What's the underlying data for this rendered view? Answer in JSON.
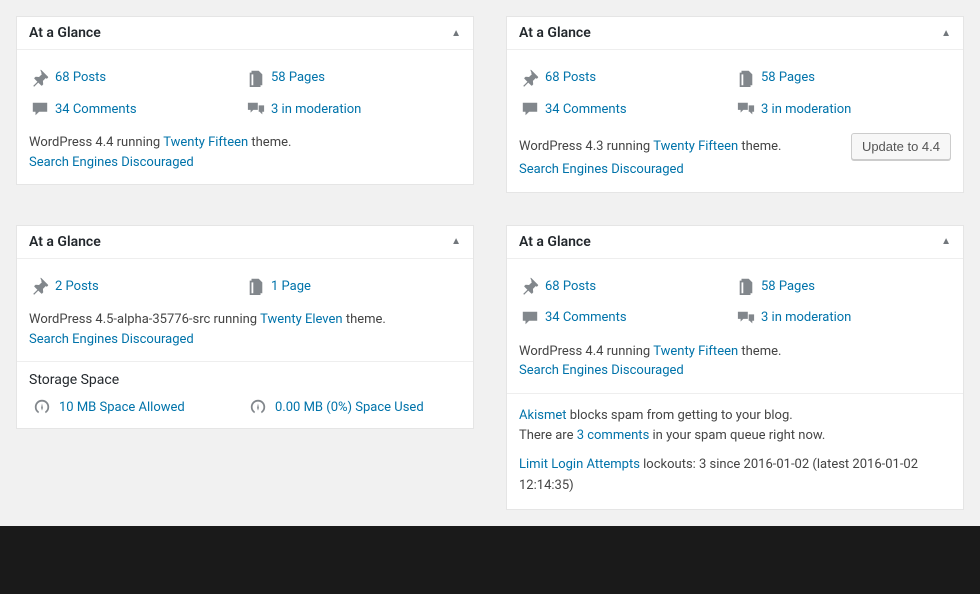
{
  "panels": {
    "p1": {
      "title": "At a Glance",
      "posts": "68 Posts",
      "pages": "58 Pages",
      "comments": "34 Comments",
      "moderation": "3 in moderation",
      "version_pre": "WordPress 4.4 running ",
      "theme": "Twenty Fifteen",
      "version_post": " theme.",
      "search_engines": "Search Engines Discouraged"
    },
    "p2": {
      "title": "At a Glance",
      "posts": "68 Posts",
      "pages": "58 Pages",
      "comments": "34 Comments",
      "moderation": "3 in moderation",
      "version_pre": "WordPress 4.3 running ",
      "theme": "Twenty Fifteen",
      "version_post": " theme.",
      "search_engines": "Search Engines Discouraged",
      "update_btn": "Update to 4.4"
    },
    "p3": {
      "title": "At a Glance",
      "posts": "2 Posts",
      "pages": "1 Page",
      "version_pre": "WordPress 4.5-alpha-35776-src running ",
      "theme": "Twenty Eleven",
      "version_post": " theme.",
      "search_engines": "Search Engines Discouraged",
      "storage_title": "Storage Space",
      "space_allowed": "10 MB Space Allowed",
      "space_used": "0.00 MB (0%) Space Used"
    },
    "p4": {
      "title": "At a Glance",
      "posts": "68 Posts",
      "pages": "58 Pages",
      "comments": "34 Comments",
      "moderation": "3 in moderation",
      "version_pre": "WordPress 4.4 running ",
      "theme": "Twenty Fifteen",
      "version_post": " theme.",
      "search_engines": "Search Engines Discouraged",
      "akismet_link": "Akismet",
      "akismet_text": " blocks spam from getting to your blog.",
      "spam_pre": "There are ",
      "spam_link": "3 comments",
      "spam_post": " in your spam queue right now.",
      "lla_link": "Limit Login Attempts",
      "lla_text": " lockouts: 3 since 2016-01-02 (latest 2016-01-02 12:14:35)"
    }
  }
}
